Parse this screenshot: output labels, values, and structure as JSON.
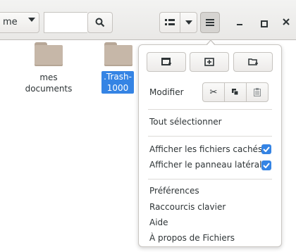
{
  "header": {
    "sort_combo_text": "me",
    "search_input_value": "",
    "window_controls": [
      "minimize-icon",
      "maximize-icon",
      "close-icon"
    ]
  },
  "files": [
    {
      "name": "mes\ndocuments",
      "line1": "mes",
      "line2": "documents",
      "selected": false
    },
    {
      "name": ".Trash-1000",
      "line1": ".Trash-",
      "line2": "1000",
      "selected": true
    }
  ],
  "menu": {
    "top_buttons": [
      "new-window-icon",
      "new-tab-icon",
      "new-folder-icon"
    ],
    "edit_label": "Modifier",
    "edit_buttons": [
      "cut-icon",
      "copy-icon",
      "paste-icon"
    ],
    "select_all": "Tout sélectionner",
    "show_hidden": "Afficher les fichiers cachés",
    "show_hidden_checked": true,
    "show_sidebar": "Afficher le panneau latéral",
    "show_sidebar_checked": true,
    "preferences": "Préférences",
    "shortcuts": "Raccourcis clavier",
    "help": "Aide",
    "about": "À propos de Fichiers"
  },
  "colors": {
    "accent": "#3584e4",
    "folder": "#c6b7a8"
  }
}
